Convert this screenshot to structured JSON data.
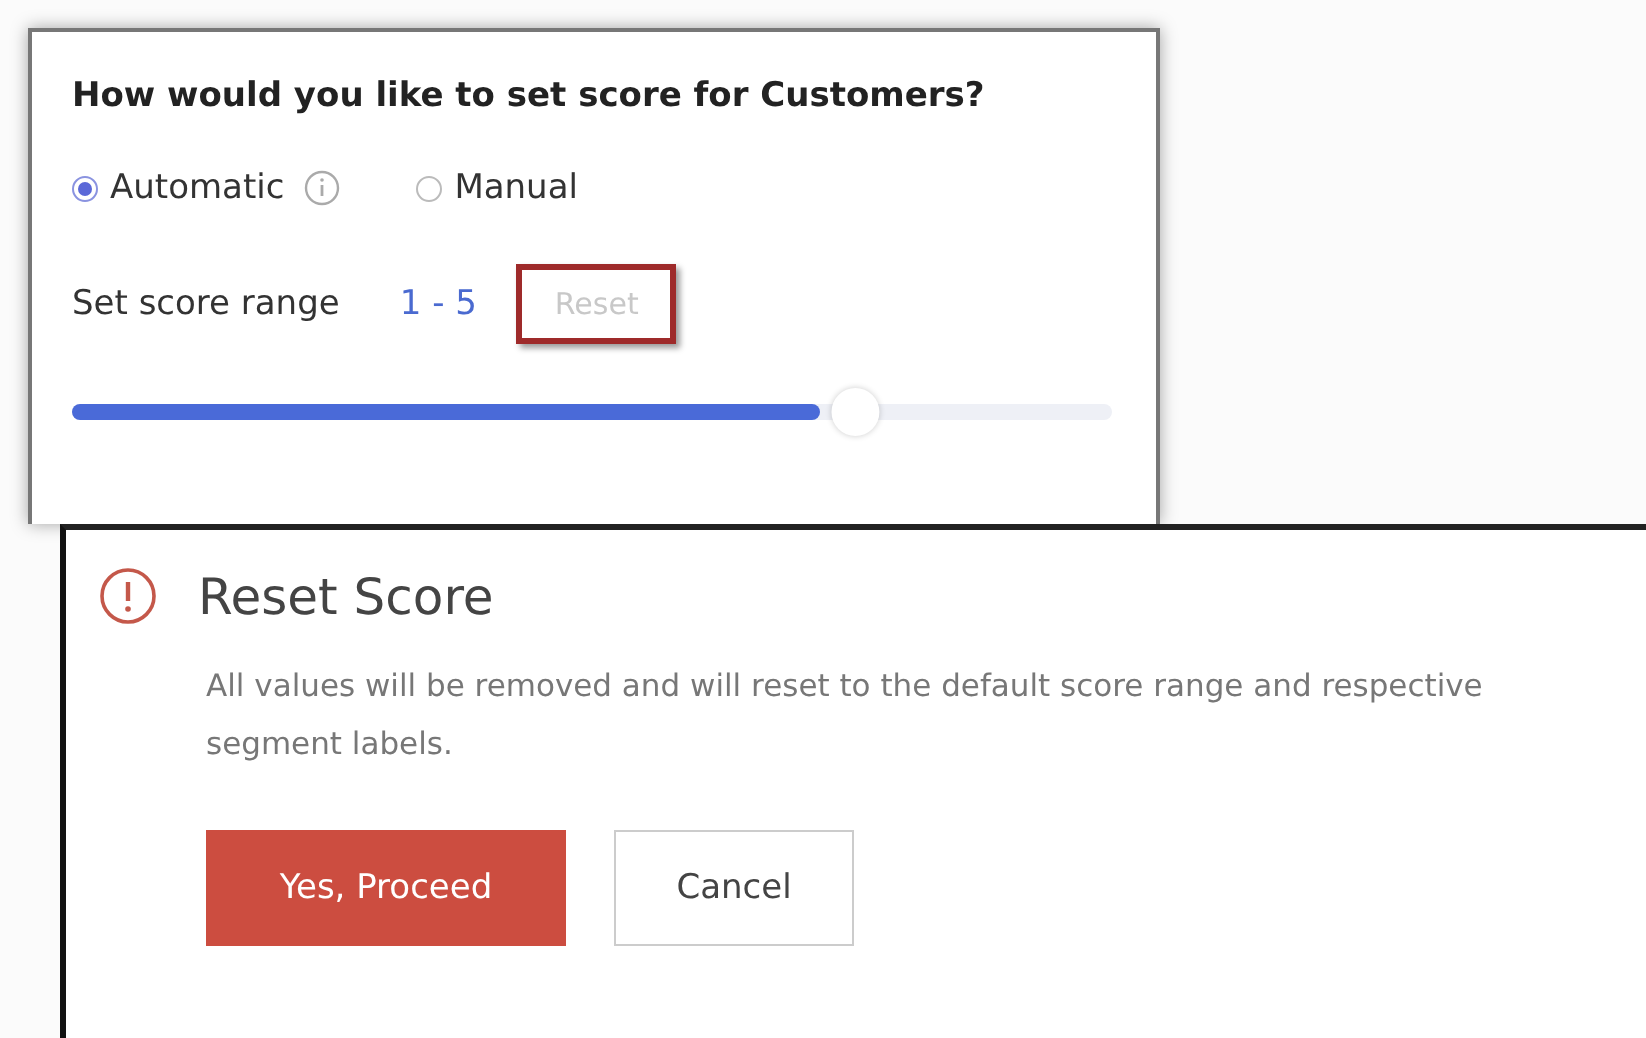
{
  "score_panel": {
    "question": "How would you like to set score for Customers?",
    "options": [
      {
        "label": "Automatic",
        "selected": true,
        "info": true
      },
      {
        "label": "Manual",
        "selected": false,
        "info": false
      }
    ],
    "range_label": "Set score range",
    "range_value": "1 - 5",
    "reset_button": {
      "label": "Reset",
      "disabled": true,
      "highlighted": true
    },
    "slider": {
      "level": 0.72
    }
  },
  "dialog": {
    "title": "Reset Score",
    "message": "All values will be removed and will reset to the default score range and respective segment labels.",
    "buttons": [
      {
        "label": "Yes, Proceed",
        "kind": "primary"
      },
      {
        "label": "Cancel",
        "kind": "secondary"
      }
    ]
  }
}
